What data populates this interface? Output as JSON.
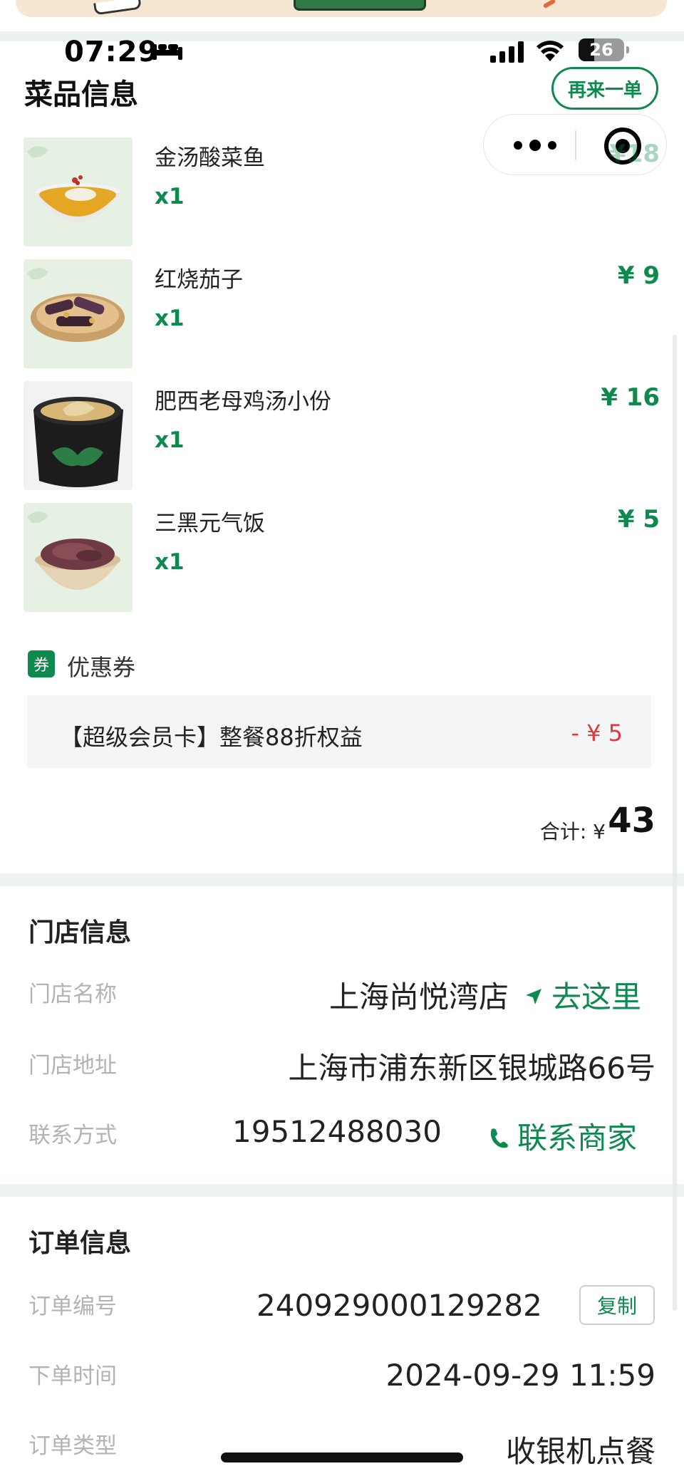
{
  "status_bar": {
    "time": "07:29",
    "battery": "26"
  },
  "header": {
    "title": "菜品信息",
    "reorder_label": "再来一单"
  },
  "dishes": [
    {
      "name": "金汤酸菜鱼",
      "qty": "x1",
      "price": "¥18"
    },
    {
      "name": "红烧茄子",
      "qty": "x1",
      "price": "¥ 9"
    },
    {
      "name": "肥西老母鸡汤小份",
      "qty": "x1",
      "price": "¥ 16"
    },
    {
      "name": "三黑元气饭",
      "qty": "x1",
      "price": "¥ 5"
    }
  ],
  "coupon": {
    "badge": "券",
    "label": "优惠券",
    "text": "【超级会员卡】整餐88折权益",
    "amount": "- ¥ 5"
  },
  "total": {
    "label": "合计: ¥",
    "value": "43"
  },
  "store": {
    "title": "门店信息",
    "name_label": "门店名称",
    "name": "上海尚悦湾店",
    "navigate": "去这里",
    "address_label": "门店地址",
    "address": "上海市浦东新区银城路66号",
    "contact_label": "联系方式",
    "phone": "19512488030",
    "contact_action": "联系商家"
  },
  "order": {
    "title": "订单信息",
    "number_label": "订单编号",
    "number": "240929000129282",
    "copy": "复制",
    "time_label": "下单时间",
    "time": "2024-09-29 11:59",
    "type_label": "订单类型",
    "type": "收银机点餐"
  },
  "colors": {
    "accent": "#0e8a4e",
    "discount": "#e03a3a"
  }
}
